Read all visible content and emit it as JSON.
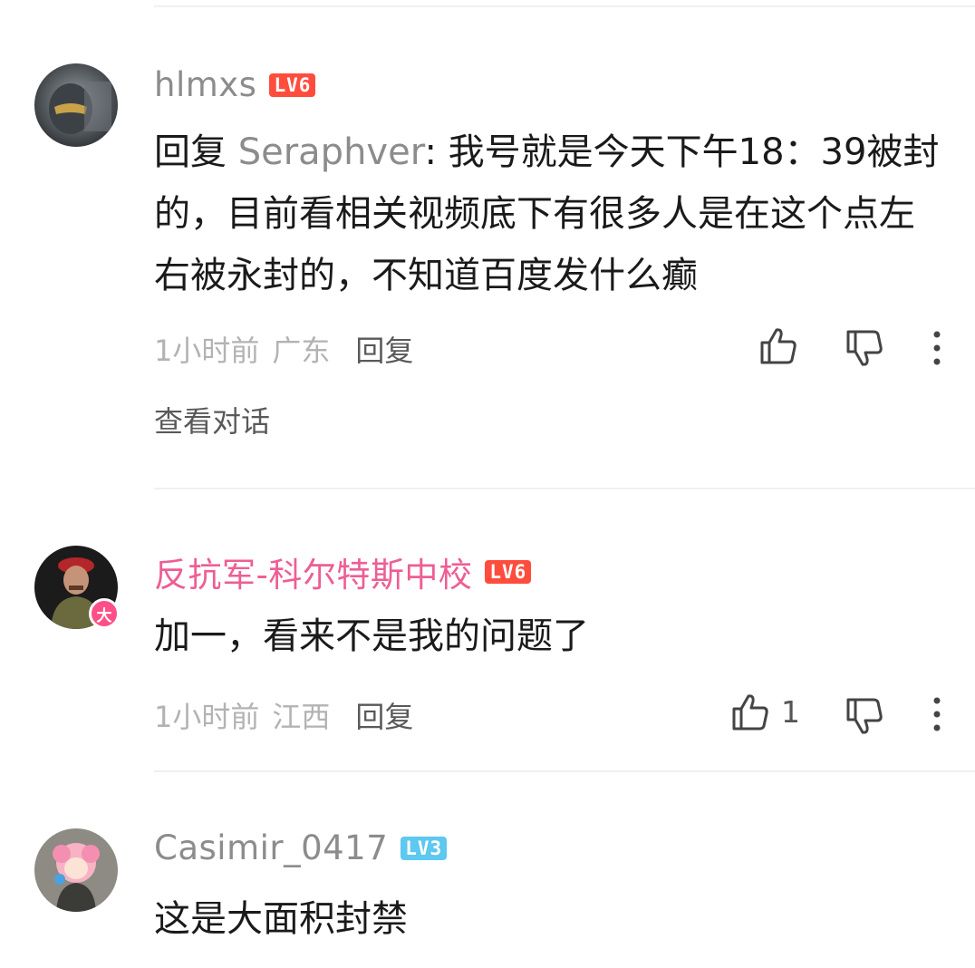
{
  "comments": [
    {
      "username": "hlmxs",
      "level": "LV6",
      "reply_prefix": "回复 ",
      "reply_target": "Seraphver",
      "text": ": 我号就是今天下午18：39被封的，目前看相关视频底下有很多人是在这个点左右被永封的，不知道百度发什么癫",
      "time": "1小时前",
      "location": "广东",
      "reply_label": "回复",
      "likes": "",
      "view_conversation": "查看对话"
    },
    {
      "username": "反抗军-科尔特斯中校",
      "level": "LV6",
      "vip_badge": "大",
      "text": "加一，看来不是我的问题了",
      "time": "1小时前",
      "location": "江西",
      "reply_label": "回复",
      "likes": "1"
    },
    {
      "username": "Casimir_0417",
      "level": "LV3",
      "text": "这是大面积封禁"
    }
  ],
  "colors": {
    "level_red": "#ff4d3d",
    "level_blue": "#5dc8f0",
    "username_pink": "#ee5e94",
    "username_gray": "#8c8c8c"
  },
  "icons": [
    "like-icon",
    "dislike-icon",
    "more-icon"
  ]
}
